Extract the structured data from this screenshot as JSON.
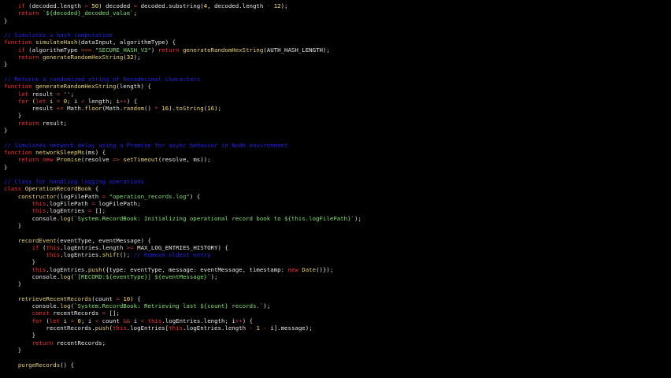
{
  "colors": {
    "background": "#000000",
    "plain": "#e6e6e6",
    "keyword": "#ff3030",
    "function": "#e8d36a",
    "string": "#7ee06b",
    "number": "#ffe14d",
    "comment": "#2424ee",
    "property": "#e6e6e6",
    "operator": "#d04040"
  },
  "editor": {
    "lines": [
      [
        [
          "kw",
          "    if"
        ],
        [
          "p",
          " (decoded.length "
        ],
        [
          "op",
          ">"
        ],
        [
          "p",
          " "
        ],
        [
          "num",
          "50"
        ],
        [
          "p",
          ") decoded "
        ],
        [
          "op",
          "="
        ],
        [
          "p",
          " decoded.substring("
        ],
        [
          "num",
          "4"
        ],
        [
          "p",
          ", decoded.length "
        ],
        [
          "op",
          "-"
        ],
        [
          "p",
          " "
        ],
        [
          "num",
          "12"
        ],
        [
          "p",
          ");"
        ]
      ],
      [
        [
          "kw",
          "    return"
        ],
        [
          "p",
          " "
        ],
        [
          "str",
          "`${decoded}_decoded_value`"
        ],
        [
          "p",
          ";"
        ]
      ],
      [
        [
          "p",
          "}"
        ]
      ],
      [
        [
          "p",
          ""
        ]
      ],
      [
        [
          "cm",
          "// Simulates a hash computation"
        ]
      ],
      [
        [
          "kw",
          "function"
        ],
        [
          "p",
          " "
        ],
        [
          "fn",
          "simulateHash"
        ],
        [
          "p",
          "(dataInput, algorithmType) {"
        ]
      ],
      [
        [
          "kw",
          "    if"
        ],
        [
          "p",
          " (algorithmType "
        ],
        [
          "op",
          "==="
        ],
        [
          "p",
          " "
        ],
        [
          "str",
          "\"SECURE_HASH_V3\""
        ],
        [
          "p",
          ") "
        ],
        [
          "kw",
          "return"
        ],
        [
          "p",
          " "
        ],
        [
          "fn",
          "generateRandomHexString"
        ],
        [
          "p",
          "(AUTH_HASH_LENGTH);"
        ]
      ],
      [
        [
          "kw",
          "    return"
        ],
        [
          "p",
          " "
        ],
        [
          "fn",
          "generateRandomHexString"
        ],
        [
          "p",
          "("
        ],
        [
          "num",
          "32"
        ],
        [
          "p",
          ");"
        ]
      ],
      [
        [
          "p",
          "}"
        ]
      ],
      [
        [
          "p",
          ""
        ]
      ],
      [
        [
          "cm",
          "// Returns a randomized string of hexadecimal characters"
        ]
      ],
      [
        [
          "kw",
          "function"
        ],
        [
          "p",
          " "
        ],
        [
          "fn",
          "generateRandomHexString"
        ],
        [
          "p",
          "(length) {"
        ]
      ],
      [
        [
          "kw",
          "    let"
        ],
        [
          "p",
          " result "
        ],
        [
          "op",
          "="
        ],
        [
          "p",
          " "
        ],
        [
          "str",
          "''"
        ],
        [
          "p",
          ";"
        ]
      ],
      [
        [
          "kw",
          "    for"
        ],
        [
          "p",
          " ("
        ],
        [
          "kw",
          "let"
        ],
        [
          "p",
          " i "
        ],
        [
          "op",
          "="
        ],
        [
          "p",
          " "
        ],
        [
          "num",
          "0"
        ],
        [
          "p",
          "; i "
        ],
        [
          "op",
          "<"
        ],
        [
          "p",
          " length; i"
        ],
        [
          "op",
          "++"
        ],
        [
          "p",
          ") {"
        ]
      ],
      [
        [
          "p",
          "        result "
        ],
        [
          "op",
          "+="
        ],
        [
          "p",
          " Math."
        ],
        [
          "fn",
          "floor"
        ],
        [
          "p",
          "(Math."
        ],
        [
          "fn",
          "random"
        ],
        [
          "p",
          "() "
        ],
        [
          "op",
          "*"
        ],
        [
          "p",
          " "
        ],
        [
          "num",
          "16"
        ],
        [
          "p",
          ")."
        ],
        [
          "fn",
          "toString"
        ],
        [
          "p",
          "("
        ],
        [
          "num",
          "16"
        ],
        [
          "p",
          ");"
        ]
      ],
      [
        [
          "p",
          "    }"
        ]
      ],
      [
        [
          "kw",
          "    return"
        ],
        [
          "p",
          " result;"
        ]
      ],
      [
        [
          "p",
          "}"
        ]
      ],
      [
        [
          "p",
          ""
        ]
      ],
      [
        [
          "cm",
          "// Simulates network delay using a Promise for async behavior in Node environment"
        ]
      ],
      [
        [
          "kw",
          "function"
        ],
        [
          "p",
          " "
        ],
        [
          "fn",
          "networkSleepMs"
        ],
        [
          "p",
          "(ms) {"
        ]
      ],
      [
        [
          "kw",
          "    return"
        ],
        [
          "p",
          " "
        ],
        [
          "kw",
          "new"
        ],
        [
          "p",
          " "
        ],
        [
          "fn",
          "Promise"
        ],
        [
          "p",
          "(resolve "
        ],
        [
          "op",
          "=>"
        ],
        [
          "p",
          " "
        ],
        [
          "fn",
          "setTimeout"
        ],
        [
          "p",
          "(resolve, ms));"
        ]
      ],
      [
        [
          "p",
          "}"
        ]
      ],
      [
        [
          "p",
          ""
        ]
      ],
      [
        [
          "cm",
          "// Class for handling logging operations"
        ]
      ],
      [
        [
          "kw",
          "class"
        ],
        [
          "p",
          " "
        ],
        [
          "fn",
          "OperationRecordBook"
        ],
        [
          "p",
          " {"
        ]
      ],
      [
        [
          "p",
          "    "
        ],
        [
          "fn",
          "constructor"
        ],
        [
          "p",
          "(logFilePath "
        ],
        [
          "op",
          "="
        ],
        [
          "p",
          " "
        ],
        [
          "str",
          "\"operation_records.log\""
        ],
        [
          "p",
          ") {"
        ]
      ],
      [
        [
          "kw",
          "        this"
        ],
        [
          "p",
          ".logFilePath "
        ],
        [
          "op",
          "="
        ],
        [
          "p",
          " logFilePath;"
        ]
      ],
      [
        [
          "kw",
          "        this"
        ],
        [
          "p",
          ".logEntries "
        ],
        [
          "op",
          "="
        ],
        [
          "p",
          " [];"
        ]
      ],
      [
        [
          "p",
          "        console."
        ],
        [
          "fn",
          "log"
        ],
        [
          "p",
          "("
        ],
        [
          "str",
          "`System.RecordBook: Initializing operational record book to ${this.logFilePath}`"
        ],
        [
          "p",
          ");"
        ]
      ],
      [
        [
          "p",
          "    }"
        ]
      ],
      [
        [
          "p",
          ""
        ]
      ],
      [
        [
          "p",
          "    "
        ],
        [
          "fn",
          "recordEvent"
        ],
        [
          "p",
          "(eventType, eventMessage) {"
        ]
      ],
      [
        [
          "kw",
          "        if"
        ],
        [
          "p",
          " ("
        ],
        [
          "kw",
          "this"
        ],
        [
          "p",
          ".logEntries.length "
        ],
        [
          "op",
          ">="
        ],
        [
          "p",
          " MAX_LOG_ENTRIES_HISTORY) {"
        ]
      ],
      [
        [
          "kw",
          "            this"
        ],
        [
          "p",
          ".logEntries."
        ],
        [
          "fn",
          "shift"
        ],
        [
          "p",
          "(); "
        ],
        [
          "cm",
          "// Remove oldest entry"
        ]
      ],
      [
        [
          "p",
          "        }"
        ]
      ],
      [
        [
          "kw",
          "        this"
        ],
        [
          "p",
          ".logEntries."
        ],
        [
          "fn",
          "push"
        ],
        [
          "p",
          "({type: eventType, message: eventMessage, timestamp: "
        ],
        [
          "kw",
          "new"
        ],
        [
          "p",
          " "
        ],
        [
          "fn",
          "Date"
        ],
        [
          "p",
          "()});"
        ]
      ],
      [
        [
          "p",
          "        console."
        ],
        [
          "fn",
          "log"
        ],
        [
          "p",
          "("
        ],
        [
          "str",
          "`[RECORD:${eventType}] ${eventMessage}`"
        ],
        [
          "p",
          ");"
        ]
      ],
      [
        [
          "p",
          "    }"
        ]
      ],
      [
        [
          "p",
          ""
        ]
      ],
      [
        [
          "p",
          "    "
        ],
        [
          "fn",
          "retrieveRecentRecords"
        ],
        [
          "p",
          "(count "
        ],
        [
          "op",
          "="
        ],
        [
          "p",
          " "
        ],
        [
          "num",
          "10"
        ],
        [
          "p",
          ") {"
        ]
      ],
      [
        [
          "p",
          "        console."
        ],
        [
          "fn",
          "log"
        ],
        [
          "p",
          "("
        ],
        [
          "str",
          "`System.RecordBook: Retrieving last ${count} records.`"
        ],
        [
          "p",
          ");"
        ]
      ],
      [
        [
          "kw",
          "        const"
        ],
        [
          "p",
          " recentRecords "
        ],
        [
          "op",
          "="
        ],
        [
          "p",
          " [];"
        ]
      ],
      [
        [
          "kw",
          "        for"
        ],
        [
          "p",
          " ("
        ],
        [
          "kw",
          "let"
        ],
        [
          "p",
          " i "
        ],
        [
          "op",
          "="
        ],
        [
          "p",
          " "
        ],
        [
          "num",
          "0"
        ],
        [
          "p",
          "; i "
        ],
        [
          "op",
          "<"
        ],
        [
          "p",
          " count "
        ],
        [
          "op",
          "&&"
        ],
        [
          "p",
          " i "
        ],
        [
          "op",
          "<"
        ],
        [
          "p",
          " "
        ],
        [
          "kw",
          "this"
        ],
        [
          "p",
          ".logEntries.length; i"
        ],
        [
          "op",
          "++"
        ],
        [
          "p",
          ") {"
        ]
      ],
      [
        [
          "p",
          "            recentRecords."
        ],
        [
          "fn",
          "push"
        ],
        [
          "p",
          "("
        ],
        [
          "kw",
          "this"
        ],
        [
          "p",
          ".logEntries["
        ],
        [
          "kw",
          "this"
        ],
        [
          "p",
          ".logEntries.length "
        ],
        [
          "op",
          "-"
        ],
        [
          "p",
          " "
        ],
        [
          "num",
          "1"
        ],
        [
          "p",
          " "
        ],
        [
          "op",
          "-"
        ],
        [
          "p",
          " i].message);"
        ]
      ],
      [
        [
          "p",
          "        }"
        ]
      ],
      [
        [
          "kw",
          "        return"
        ],
        [
          "p",
          " recentRecords;"
        ]
      ],
      [
        [
          "p",
          "    }"
        ]
      ],
      [
        [
          "p",
          ""
        ]
      ],
      [
        [
          "p",
          "    "
        ],
        [
          "fn",
          "purgeRecords"
        ],
        [
          "p",
          "() {"
        ]
      ]
    ]
  }
}
